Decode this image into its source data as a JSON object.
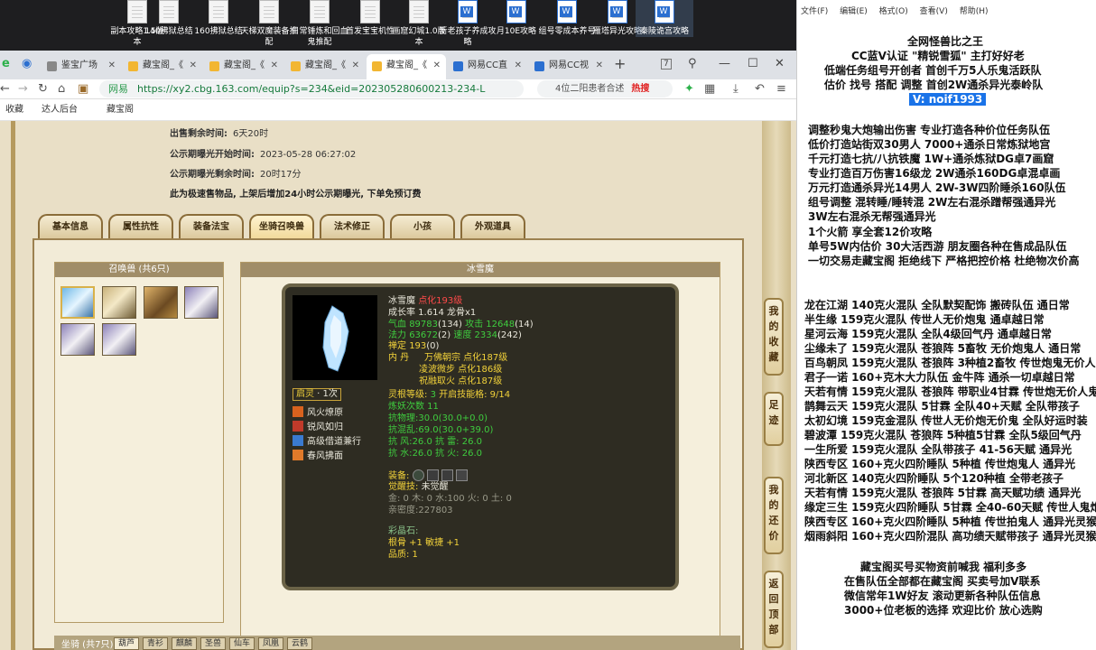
{
  "desktop_icons": [
    {
      "label": "副本攻略1.5版本",
      "type": "doc"
    },
    {
      "label": "140拂狱总结",
      "type": "doc"
    },
    {
      "label": "160拂狱总结",
      "type": "doc"
    },
    {
      "label": "天梯双魔装备推配",
      "type": "doc"
    },
    {
      "label": "日常锤炼和回血鬼推配",
      "type": "doc"
    },
    {
      "label": "首发宝宝机性",
      "type": "doc"
    },
    {
      "label": "画窟幻城1.0版本",
      "type": "doc"
    },
    {
      "label": "新老孩子养成攻略",
      "type": "word"
    },
    {
      "label": "月10E攻略",
      "type": "word"
    },
    {
      "label": "组号零成本养号",
      "type": "word"
    },
    {
      "label": "雁塔异光攻略",
      "type": "word"
    },
    {
      "label": "秦陵诡宫攻略",
      "type": "word"
    }
  ],
  "browser": {
    "tabs": [
      {
        "label": "鉴宝广场",
        "active": false
      },
      {
        "label": "藏宝阁_《",
        "active": false
      },
      {
        "label": "藏宝阁_《",
        "active": false
      },
      {
        "label": "藏宝阁_《",
        "active": false
      },
      {
        "label": "藏宝阁_《",
        "active": true
      },
      {
        "label": "网易CC直",
        "active": false
      },
      {
        "label": "网易CC视",
        "active": false
      }
    ],
    "tab_count": "7",
    "url_site": "网易",
    "url": "https://xy2.cbg.163.com/equip?s=234&eid=202305280600213-234-L",
    "search_text": "4位二阳患者合述",
    "search_hot": "热搜",
    "bookmarks": [
      "收藏",
      "达人后台",
      "藏宝阁"
    ]
  },
  "listing": {
    "rows": [
      {
        "label": "出售剩余时间:",
        "value": "6天20时"
      },
      {
        "label": "公示期曝光开始时间:",
        "value": "2023-05-28 06:27:02"
      },
      {
        "label": "公示期曝光剩余时间:",
        "value": "20时17分"
      }
    ],
    "notice": "此为极速售物品, 上架后增加24小时公示期曝光, 下单免预订费"
  },
  "page_tabs": [
    "基本信息",
    "属性抗性",
    "装备法宝",
    "坐骑召唤兽",
    "法术修正",
    "小孩",
    "外观道具"
  ],
  "pet_list": {
    "header": "召唤兽 (共6只)"
  },
  "pet_detail": {
    "header": "冰雪魔",
    "name": "冰雪魔",
    "level": "点化193级",
    "growth": "成长率 1.614 龙骨x1",
    "hp_label": "气血",
    "hp": "89783",
    "hp_pts": "(134)",
    "atk_label": "攻击",
    "atk": "12648",
    "atk_pts": "(14)",
    "mp_label": "法力",
    "mp": "63672",
    "mp_pts": "(2)",
    "spd_label": "速度",
    "spd": "2334",
    "spd_pts": "(242)",
    "zen_label": "禅定",
    "zen": "193",
    "zen_pts": "(0)",
    "inner_label": "内  丹",
    "inner": [
      "万佛朝宗 点化187级",
      "凌波微步 点化186级",
      "祝融取火 点化187级"
    ],
    "spirit_label": "启灵",
    "spirit_val": "1次",
    "lingen_label": "灵根等级:",
    "lingen": "3",
    "skill_grid": "开启技能格: 9/14",
    "refine": "炼妖次数 11",
    "resists": [
      {
        "label": "抗物理:",
        "value": "30.0(30.0+0.0)"
      },
      {
        "label": "抗混乱:",
        "value": "69.0(30.0+39.0)"
      },
      {
        "label": "抗  风:",
        "value": "26.0 抗  雷: 26.0"
      },
      {
        "label": "抗  水:",
        "value": "26.0 抗  火: 26.0"
      }
    ],
    "skills": [
      "风火燎原",
      "锐风如归",
      "高级借道兼行",
      "春风拂面"
    ],
    "equip_label": "装备:",
    "awaken_label": "觉醒技:",
    "awaken_val": "未觉醒",
    "elements": "金: 0 木: 0 水:100 火: 0 土: 0",
    "intimacy": "亲密度:227803",
    "stone_label": "彩晶石:",
    "stone": "根骨 +1 敏捷 +1",
    "quality": "品质: 1"
  },
  "bottom": {
    "label": "坐骑 (共7只)",
    "tabs": [
      "葫芦",
      "青衫",
      "麒麟",
      "圣兽",
      "仙车",
      "凤凰",
      "云鹤"
    ]
  },
  "side_buttons": [
    "我的收藏",
    "足迹",
    "我的还价",
    "返回顶部"
  ],
  "notepad": {
    "menu": [
      "文件(F)",
      "编辑(E)",
      "格式(O)",
      "查看(V)",
      "帮助(H)"
    ],
    "header_lines": [
      "全网怪兽比之王",
      "CC蓝V认证 \"精锐雪狐\" 主打好好老",
      "低端任务组号开创者           首创千万5人乐鬼活跃队",
      "估价 找号 搭配 调整          首创2W通杀异光泰岭队"
    ],
    "contact": "V: noif1993",
    "services": [
      "调整秒鬼大炮输出伤害           专业打造各种价位任务队伍",
      "低价打造站街双30男人            7000+通杀日常炼狱地宫",
      "千元打造七抗/八抗铁魔          1W+通杀炼狱DG卓7画窟",
      "专业打造百万伤害16级龙          2W通杀160DG卓混卓画",
      "万元打造通杀异光14男人         2W-3W四阶睡杀160队伍",
      "组号调整 混转睡/睡转混          2W左右混杀蹭帮强通异光",
      "                               3W左右混杀无帮强通异光",
      "1个火箭 享全套12价攻略",
      "单号5W内估价 30大活西游        朋友圈各种在售成品队伍",
      "一切交易走藏宝阁 拒绝线下      严格把控价格 杜绝物次价高"
    ],
    "teams": [
      "龙在江湖 140克火混队 全队默契配饰 搬砖队伍 通日常",
      "半生缘     159克火混队 传世人无价炮鬼 通卓越日常",
      "星河云海 159克火混队 全队4级回气丹 通卓越日常",
      "尘缘未了 159克火混队 苍狼阵 5畜牧 无价炮鬼人 通日常",
      "百鸟朝凤 159克火混队 苍狼阵 3种植2畜牧 传世炮鬼无价人",
      "君子一诺 160+克木大力队伍 金牛阵 通杀一切卓越日常",
      "天若有情 159克火混队 苍狼阵 带职业4甘霖 传世炮无价人鬼",
      "鹊舞云天 159克火混队 5甘霖 全队40+天赋 全队带孩子",
      "太初幻境 159克金混队 传世人无价炮无价鬼 全队好运时装",
      "碧波潭     159克火混队 苍狼阵 5种植5甘霖 全队5级回气丹",
      "一生所爱 159克火混队 全队带孩子 41-56天赋 通异光",
      "陕西专区 160+克火四阶睡队 5种植 传世炮鬼人 通异光",
      "河北新区 140克火四阶睡队 5个120种植 全带老孩子",
      "天若有情 159克火混队 苍狼阵 5甘霖 高天赋功绩 通异光",
      "缘定三生 159克火四阶睡队 5甘霖 全40-60天赋 传世人鬼炮",
      "陕西专区 160+克火四阶睡队 5种植 传世拍鬼人 通异光灵猴",
      "烟雨斜阳 160+克火四阶混队 高功绩天赋带孩子 通异光灵猴"
    ],
    "footer": [
      "藏宝阁买号买物资前喊我  福利多多",
      "在售队伍全部都在藏宝阁 买卖号加V联系",
      "微信常年1W好友 滚动更新各种队伍信息",
      "3000+位老板的选择 欢迎比价 放心选购"
    ]
  }
}
